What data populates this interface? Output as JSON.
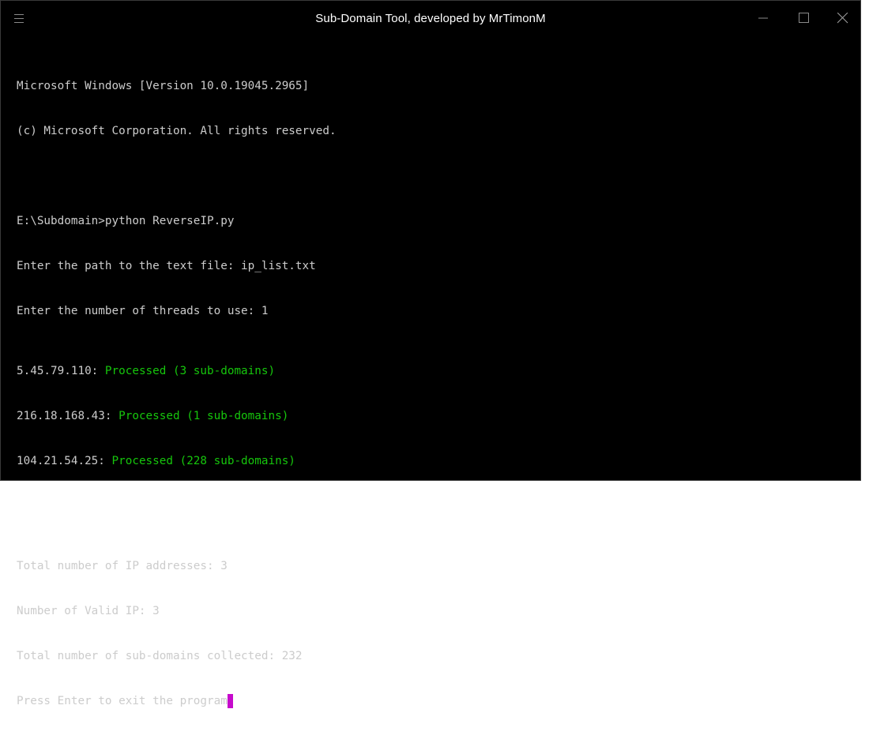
{
  "window": {
    "title": "Sub-Domain Tool, developed by MrTimonM",
    "icons": {
      "menu": "hamburger-menu-icon",
      "minimize": "minimize-icon",
      "maximize": "maximize-icon",
      "close": "close-icon"
    },
    "colors": {
      "background": "#000000",
      "text": "#cccccc",
      "success": "#16c60c",
      "cursor": "#c60acc"
    }
  },
  "terminal": {
    "header_line1": "Microsoft Windows [Version 10.0.19045.2965]",
    "header_line2": "(c) Microsoft Corporation. All rights reserved.",
    "command": "E:\\Subdomain>python ReverseIP.py",
    "prompt_file": "Enter the path to the text file: ip_list.txt",
    "prompt_threads": "Enter the number of threads to use: 1",
    "results": [
      {
        "ip": "5.45.79.110: ",
        "status": "Processed (3 sub-domains)"
      },
      {
        "ip": "216.18.168.43: ",
        "status": "Processed (1 sub-domains)"
      },
      {
        "ip": "104.21.54.25: ",
        "status": "Processed (228 sub-domains)"
      }
    ],
    "summary_total_ips": "Total number of IP addresses: 3",
    "summary_valid_ips": "Number of Valid IP: 3",
    "summary_subdomains": "Total number of sub-domains collected: 232",
    "exit_prompt": "Press Enter to exit the program"
  }
}
